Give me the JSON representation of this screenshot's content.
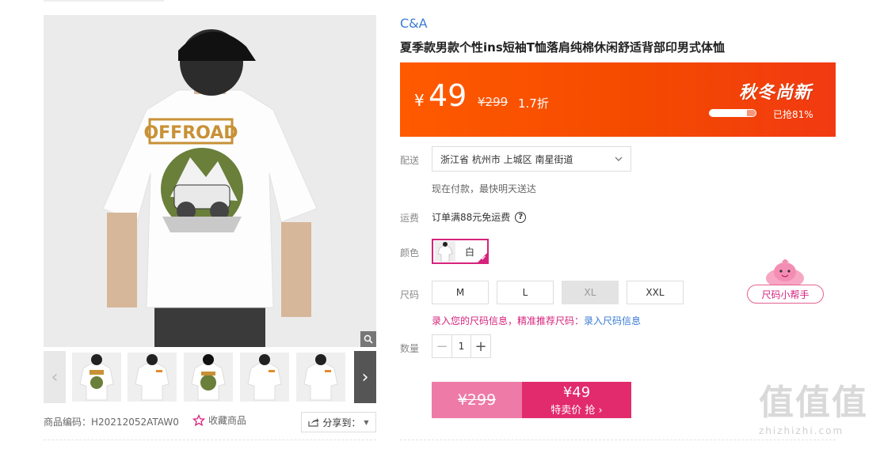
{
  "gallery": {
    "main_print_text": "OFFROAD",
    "sku_label": "商品编码：H20212052ATAW0",
    "favorite_label": "收藏商品",
    "share_label": "分享到：",
    "prev_arrow": "‹",
    "next_arrow": "›"
  },
  "product": {
    "brand": "C&A",
    "title": "夏季款男款个性ins短袖T恤落肩纯棉休闲舒适背部印男式体恤"
  },
  "price_banner": {
    "currency": "¥",
    "price": "49",
    "original_price": "¥299",
    "discount": "1.7折",
    "promo_title": "秋冬尚新",
    "grabbed_text": "已抢81%",
    "grabbed_progress": 0.81
  },
  "delivery": {
    "label": "配送",
    "address": "浙江省 杭州市 上城区 南星街道",
    "note": "现在付款，最快明天送达"
  },
  "shipping": {
    "label": "运费",
    "text": "订单满88元免运费",
    "help_icon": "?"
  },
  "color": {
    "label": "颜色",
    "selected": "白"
  },
  "size": {
    "label": "尺码",
    "options": [
      "M",
      "L",
      "XL",
      "XXL"
    ],
    "tip_text": "录入您的尺码信息，精准推荐尺码：",
    "tip_link": "录入尺码信息",
    "helper_label": "尺码小帮手"
  },
  "quantity": {
    "label": "数量",
    "minus": "−",
    "value": "1",
    "plus": "+"
  },
  "buy": {
    "original_price": "¥299",
    "sale_price": "¥49",
    "sale_label": "特卖价 抢 ›"
  },
  "watermark": {
    "big": "值值值",
    "small": "zhizhizhi.com"
  },
  "colors": {
    "banner": "#ff5a00",
    "accent_pink": "#e22b6d",
    "brand_blue": "#3a7bd5"
  }
}
